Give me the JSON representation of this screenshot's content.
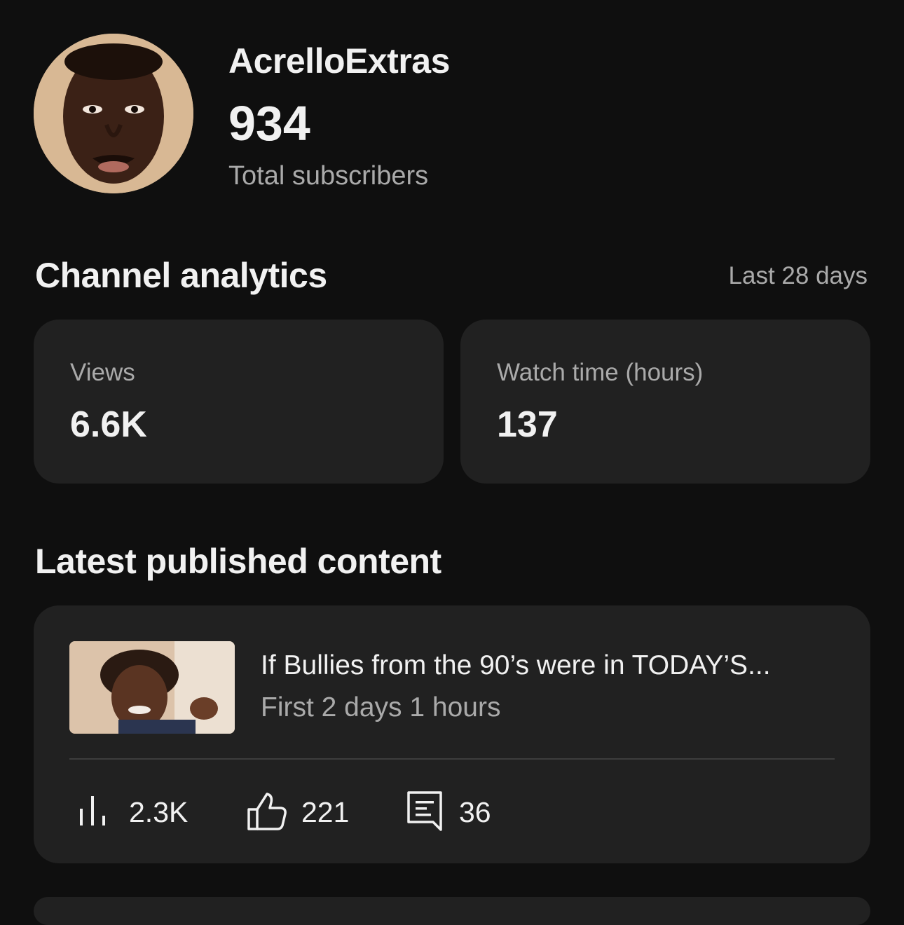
{
  "header": {
    "channel_name": "AcrelloExtras",
    "subscriber_count": "934",
    "subscriber_label": "Total subscribers"
  },
  "analytics": {
    "title": "Channel analytics",
    "range": "Last 28 days",
    "metrics": [
      {
        "label": "Views",
        "value": "6.6K"
      },
      {
        "label": "Watch time (hours)",
        "value": "137"
      }
    ]
  },
  "latest": {
    "title": "Latest published content",
    "video": {
      "title": "If Bullies from the 90’s were in TODAY’S...",
      "subtitle": "First 2 days 1 hours",
      "stats": {
        "views": "2.3K",
        "likes": "221",
        "comments": "36"
      }
    }
  },
  "colors": {
    "background": "#0f0f0f",
    "card": "#212121",
    "primary_text": "#f1f1f1",
    "secondary_text": "#aaaaaa"
  },
  "icons": [
    "views-bars-icon",
    "thumbs-up-icon",
    "comment-icon"
  ]
}
